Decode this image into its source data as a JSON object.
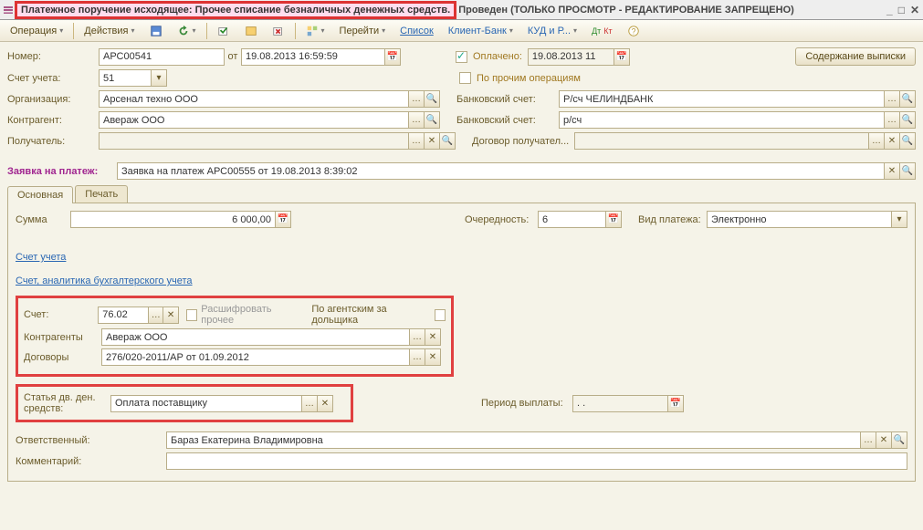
{
  "titlebar": {
    "highlighted": "Платежное поручение исходящее: Прочее списание безналичных денежных средств.",
    "rest": "Проведен (ТОЛЬКО ПРОСМОТР - РЕДАКТИРОВАНИЕ ЗАПРЕЩЕНО)"
  },
  "toolbar": {
    "operation": "Операция",
    "actions": "Действия",
    "goto": "Перейти",
    "list": "Список",
    "client_bank": "Клиент-Банк",
    "kud": "КУД и Р..."
  },
  "header": {
    "number_label": "Номер:",
    "number": "АРС00541",
    "from_label": "от",
    "date": "19.08.2013 16:59:59",
    "paid_label": "Оплачено:",
    "paid_date": "19.08.2013 11",
    "statement_btn": "Содержание выписки",
    "account_label": "Счет учета:",
    "account": "51",
    "other_ops": "По прочим операциям",
    "org_label": "Организация:",
    "org": "Арсенал техно ООО",
    "bank1_label": "Банковский счет:",
    "bank1": "Р/сч ЧЕЛИНДБАНК",
    "contr_label": "Контрагент:",
    "contr": "Авераж ООО",
    "bank2_label": "Банковский счет:",
    "bank2": "р/сч",
    "recip_label": "Получатель:",
    "recip": "",
    "dogrec_label": "Договор получател...",
    "dogrec": "",
    "request_label": "Заявка на платеж:",
    "request": "Заявка на платеж АРС00555 от 19.08.2013 8:39:02"
  },
  "tabs": {
    "main": "Основная",
    "print": "Печать"
  },
  "main": {
    "sum_label": "Сумма",
    "sum": "6 000,00",
    "priority_label": "Очередность:",
    "priority": "6",
    "paytype_label": "Вид платежа:",
    "paytype": "Электронно",
    "sect_account": "Счет учета",
    "sect_analytics": "Счет, аналитика бухгалтерского учета",
    "account_label": "Счет:",
    "account": "76.02",
    "decode": "Расшифровать прочее",
    "agent": "По агентским за дольщика",
    "contr_label": "Контрагенты",
    "contr": "Авераж ООО",
    "dog_label": "Договоры",
    "dog": "276/020-2011/АР от 01.09.2012",
    "cash_label1": "Статья дв. ден.",
    "cash_label2": "средств:",
    "cash": "Оплата поставщику",
    "period_label": "Период выплаты:",
    "period": ". .",
    "resp_label": "Ответственный:",
    "resp": "Бараз Екатерина Владимировна",
    "comment_label": "Комментарий:"
  }
}
